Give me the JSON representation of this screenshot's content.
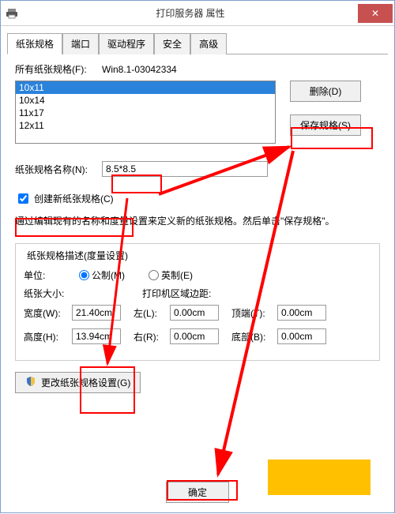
{
  "titlebar": {
    "title": "打印服务器 属性",
    "close": "✕"
  },
  "tabs": {
    "items": [
      {
        "label": "纸张规格"
      },
      {
        "label": "端口"
      },
      {
        "label": "驱动程序"
      },
      {
        "label": "安全"
      },
      {
        "label": "高级"
      }
    ]
  },
  "forms": {
    "all_forms_label": "所有纸张规格(F):",
    "server_name": "Win8.1-03042334",
    "list": [
      "10x11",
      "10x14",
      "11x17",
      "12x11"
    ],
    "delete_btn": "删除(D)",
    "save_btn": "保存规格(S)",
    "name_label": "纸张规格名称(N):",
    "name_value": "8.5*8.5",
    "create_new_label": "创建新纸张规格(C)",
    "help_text": "通过编辑现有的名称和度量设置来定义新的纸张规格。然后单击\"保存规格\"。"
  },
  "desc": {
    "group_title": "纸张规格描述(度量设置)",
    "units_label": "单位:",
    "metric_label": "公制(M)",
    "english_label": "英制(E)",
    "paper_size_label": "纸张大小:",
    "margins_label": "打印机区域边距:",
    "width_label": "宽度(W):",
    "width_value": "21.40cm",
    "height_label": "高度(H):",
    "height_value": "13.94cm",
    "left_label": "左(L):",
    "left_value": "0.00cm",
    "right_label": "右(R):",
    "right_value": "0.00cm",
    "top_label": "顶端(T):",
    "top_value": "0.00cm",
    "bottom_label": "底部(B):",
    "bottom_value": "0.00cm"
  },
  "footer": {
    "change_settings": "更改纸张规格设置(G)",
    "ok": "确定"
  },
  "colors": {
    "highlight": "#ff0000",
    "accent": "#2a82da"
  }
}
